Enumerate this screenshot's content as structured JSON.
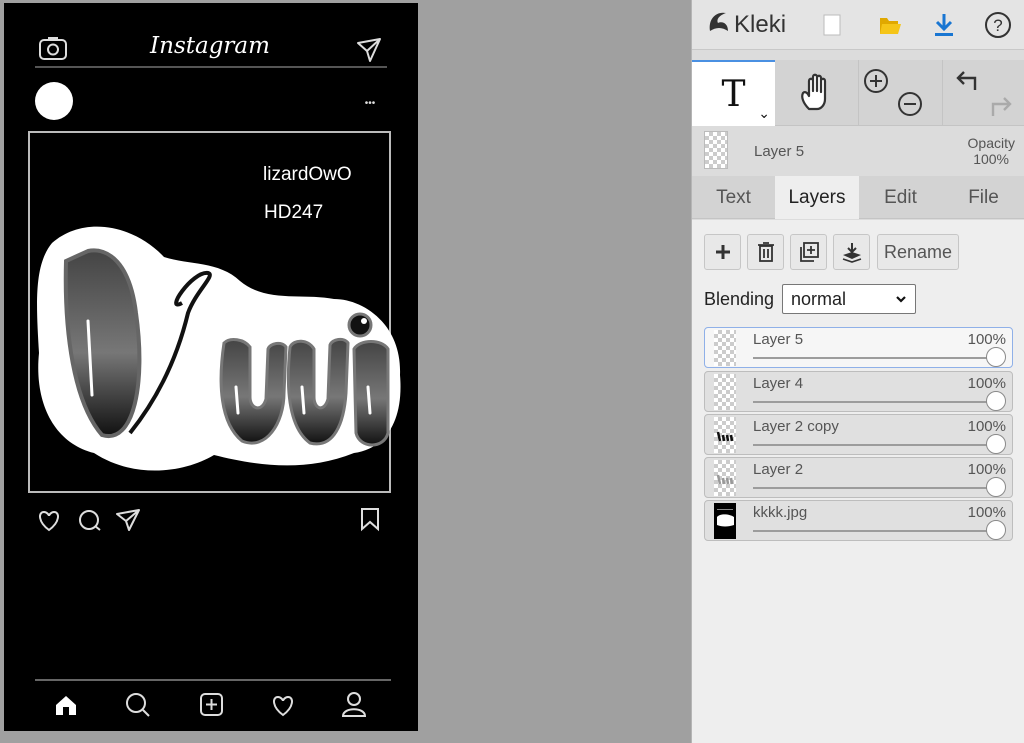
{
  "canvas": {
    "post": {
      "app_title": "Instagram",
      "text_line1": "lizardOwO",
      "text_line2": "HD247",
      "more_glyph": "•••",
      "icons": [
        "camera-icon",
        "send-icon",
        "heart-icon",
        "comment-icon",
        "share-icon",
        "bookmark-icon",
        "home-icon",
        "search-icon",
        "add-icon",
        "activity-icon",
        "profile-icon"
      ]
    }
  },
  "app": {
    "name": "Kleki",
    "topbar_icons": [
      "new-image-icon",
      "open-file-icon",
      "download-icon",
      "help-icon"
    ]
  },
  "tools": {
    "text_tool_glyph": "T",
    "caret_glyph": "⌄",
    "items": [
      "text-tool",
      "hand-tool",
      "zoom-in",
      "zoom-out",
      "undo",
      "redo"
    ]
  },
  "current_layer": {
    "name": "Layer 5",
    "opacity_label": "Opacity",
    "opacity_value": "100%"
  },
  "tabs": [
    {
      "label": "Text",
      "active": false
    },
    {
      "label": "Layers",
      "active": true
    },
    {
      "label": "Edit",
      "active": false
    },
    {
      "label": "File",
      "active": false
    }
  ],
  "layer_actions": {
    "rename_label": "Rename",
    "icons": [
      "add-layer-icon",
      "delete-layer-icon",
      "duplicate-layer-icon",
      "merge-down-icon"
    ]
  },
  "blending": {
    "label": "Blending",
    "value": "normal"
  },
  "layers": [
    {
      "name": "Layer 5",
      "opacity": "100%",
      "selected": true
    },
    {
      "name": "Layer 4",
      "opacity": "100%",
      "selected": false
    },
    {
      "name": "Layer 2 copy",
      "opacity": "100%",
      "selected": false
    },
    {
      "name": "Layer 2",
      "opacity": "100%",
      "selected": false
    },
    {
      "name": "kkkk.jpg",
      "opacity": "100%",
      "selected": false
    }
  ],
  "colors": {
    "accent": "#4a90e2",
    "download_blue": "#1976d2",
    "folder_yellow": "#f5c518"
  }
}
